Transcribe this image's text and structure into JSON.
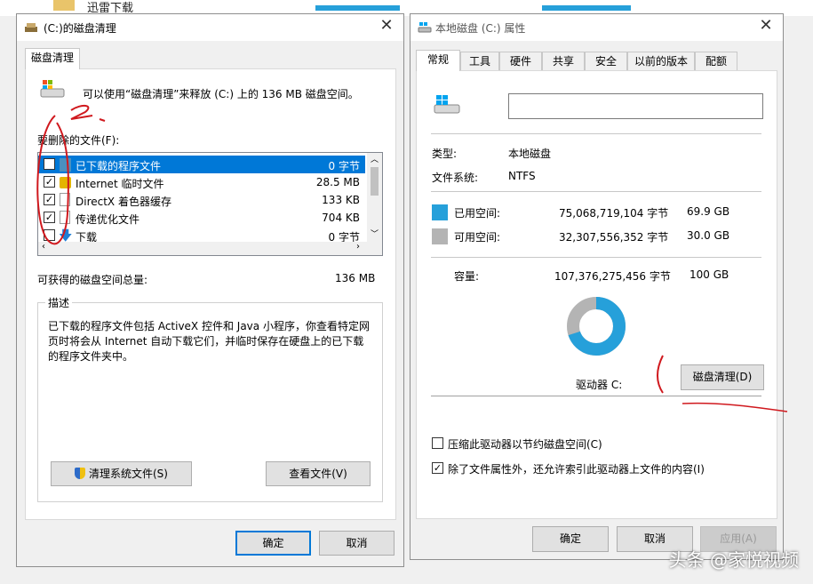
{
  "background": {
    "top_text": "迅雷下载"
  },
  "cleanup": {
    "title": "(C:)的磁盘清理",
    "tab": "磁盘清理",
    "intro": "可以使用“磁盘清理”来释放  (C:) 上的 136 MB 磁盘空间。",
    "files_label": "要删除的文件(F):",
    "items": [
      {
        "name": "已下载的程序文件",
        "size": "0 字节",
        "checked": true,
        "selected": true
      },
      {
        "name": "Internet 临时文件",
        "size": "28.5 MB",
        "checked": true,
        "selected": false
      },
      {
        "name": "DirectX 着色器缓存",
        "size": "133 KB",
        "checked": true,
        "selected": false
      },
      {
        "name": "传递优化文件",
        "size": "704 KB",
        "checked": true,
        "selected": false
      },
      {
        "name": "下载",
        "size": "0 字节",
        "checked": false,
        "selected": false
      }
    ],
    "total_label": "可获得的磁盘空间总量:",
    "total_value": "136 MB",
    "desc_group": "描述",
    "desc_text_1": "已下载的程序文件包括 ActiveX 控件和 Java 小程序，你查看特定网",
    "desc_text_2": "页时将会从 Internet 自动下载它们，并临时保存在硬盘上的已下载",
    "desc_text_3": "的程序文件夹中。",
    "clean_system_button": "清理系统文件(S)",
    "view_files_button": "查看文件(V)",
    "ok_button": "确定",
    "cancel_button": "取消"
  },
  "props": {
    "title": "本地磁盘 (C:) 属性",
    "tabs": [
      "常规",
      "工具",
      "硬件",
      "共享",
      "安全",
      "以前的版本",
      "配额"
    ],
    "name_value": "",
    "type_label": "类型:",
    "type_value": "本地磁盘",
    "fs_label": "文件系统:",
    "fs_value": "NTFS",
    "used_label": "已用空间:",
    "used_bytes": "75,068,719,104 字节",
    "used_gb": "69.9 GB",
    "free_label": "可用空间:",
    "free_bytes": "32,307,556,352 字节",
    "free_gb": "30.0 GB",
    "cap_label": "容量:",
    "cap_bytes": "107,376,275,456 字节",
    "cap_gb": "100 GB",
    "used_fraction": 0.699,
    "drive_label": "驱动器 C:",
    "cleanup_button": "磁盘清理(D)",
    "compress_label": "压缩此驱动器以节约磁盘空间(C)",
    "compress_checked": false,
    "index_label": "除了文件属性外，还允许索引此驱动器上文件的内容(I)",
    "index_checked": true,
    "ok_button": "确定",
    "cancel_button": "取消",
    "apply_button": "应用(A)"
  },
  "colors": {
    "used": "#26a0da",
    "free": "#b4b4b4",
    "accent": "#0078d7",
    "annotation": "#d0191e"
  },
  "watermark": "头条 @家悦视频"
}
